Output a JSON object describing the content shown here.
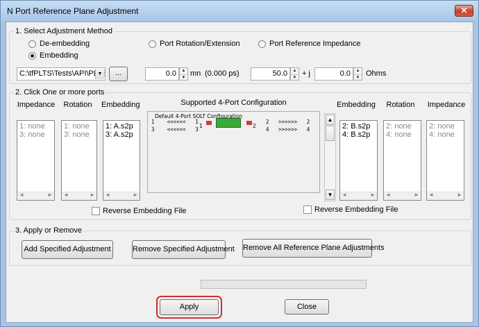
{
  "window": {
    "title": "N Port Reference Plane Adjustment",
    "close_glyph": "✕"
  },
  "section1": {
    "label": "1. Select Adjustment Method",
    "methods": [
      {
        "label": "De-embedding",
        "selected": false
      },
      {
        "label": "Embedding",
        "selected": true
      },
      {
        "label": "Port Rotation/Extension",
        "selected": false
      },
      {
        "label": "Port Reference Impedance",
        "selected": false
      }
    ],
    "file_path": "C:\\tfPLTS\\Tests\\API\\PLTS",
    "browse_label": "...",
    "extension_value": "0.0",
    "extension_unit": "mn",
    "delay_text": "(0.000 ps)",
    "impedance_real": "50.0",
    "plus_j": "+ j",
    "impedance_imag": "0.0",
    "ohms": "Ohms"
  },
  "section2": {
    "label": "2. Click One or more ports",
    "headers": {
      "impedance": "Impedance",
      "rotation": "Rotation",
      "embedding": "Embedding",
      "config": "Supported 4-Port Configuration"
    },
    "left": {
      "impedance": [
        "1: none",
        "3: none"
      ],
      "rotation": [
        "1: none",
        "3: none"
      ],
      "embedding": [
        "1: A.s2p",
        "3: A.s2p"
      ]
    },
    "right": {
      "embedding": [
        "2: B.s2p",
        "4: B.s2p"
      ],
      "rotation": [
        "2: none",
        "4: none"
      ],
      "impedance": [
        "2: none",
        "4: none"
      ]
    },
    "reverse_left": "Reverse Embedding File",
    "reverse_right": "Reverse Embedding File",
    "config_diagram": {
      "title": "Default 4-Port SOLT Configuration",
      "row1_left": "1    <<<<<<   1",
      "row2_left": "3    <<<<<<   3",
      "left_port": "1",
      "right_port": "2",
      "row1_right": "2   >>>>>>   2",
      "row2_right": "4   >>>>>>   4"
    }
  },
  "section3": {
    "label": "3. Apply or Remove",
    "add_label": "Add Specified Adjustment",
    "remove_label": "Remove Specified Adjustment",
    "remove_all_label": "Remove All Reference Plane Adjustments"
  },
  "footer": {
    "apply_label": "Apply",
    "close_label": "Close"
  },
  "icons": {
    "scroll_left": "◄",
    "scroll_right": "►",
    "scroll_up": "▲",
    "scroll_down": "▼",
    "dropdown": "▼",
    "spin_up": "▲",
    "spin_down": "▼"
  },
  "colors": {
    "highlight": "#d42c2c",
    "device_green": "#3aa83a"
  }
}
